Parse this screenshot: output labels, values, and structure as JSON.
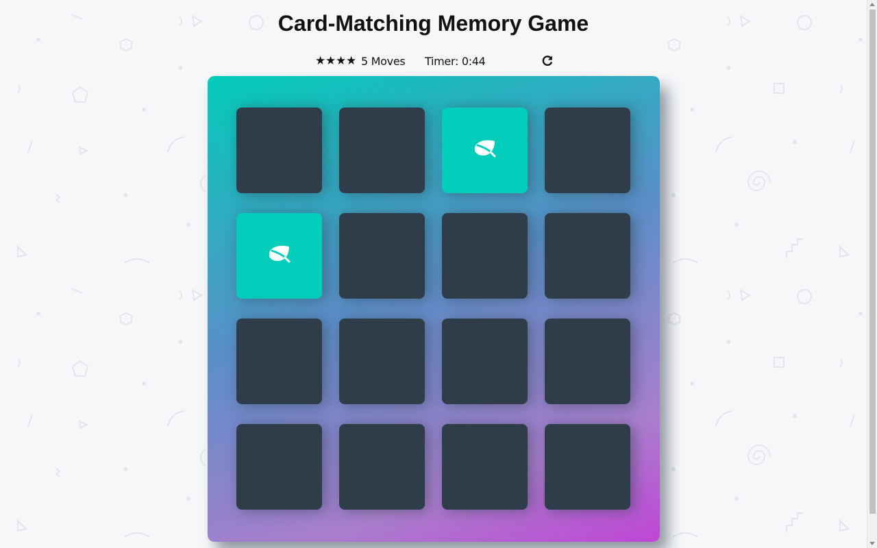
{
  "page": {
    "title": "Card-Matching Memory Game"
  },
  "score_panel": {
    "stars": [
      "★",
      "★",
      "★",
      "★"
    ],
    "moves": "5 Moves",
    "timer": "Timer: 0:44"
  },
  "deck": {
    "cards": [
      {
        "state": "closed"
      },
      {
        "state": "closed"
      },
      {
        "state": "open",
        "icon": "leaf-icon"
      },
      {
        "state": "closed"
      },
      {
        "state": "open",
        "icon": "leaf-icon"
      },
      {
        "state": "closed"
      },
      {
        "state": "closed"
      },
      {
        "state": "closed"
      },
      {
        "state": "closed"
      },
      {
        "state": "closed"
      },
      {
        "state": "closed"
      },
      {
        "state": "closed"
      },
      {
        "state": "closed"
      },
      {
        "state": "closed"
      },
      {
        "state": "closed"
      },
      {
        "state": "closed"
      }
    ]
  },
  "colors": {
    "card_closed": "#2e3d49",
    "card_open": "#02ccba",
    "deck_gradient_start": "#02ccba",
    "deck_gradient_end": "#bf45d6"
  }
}
